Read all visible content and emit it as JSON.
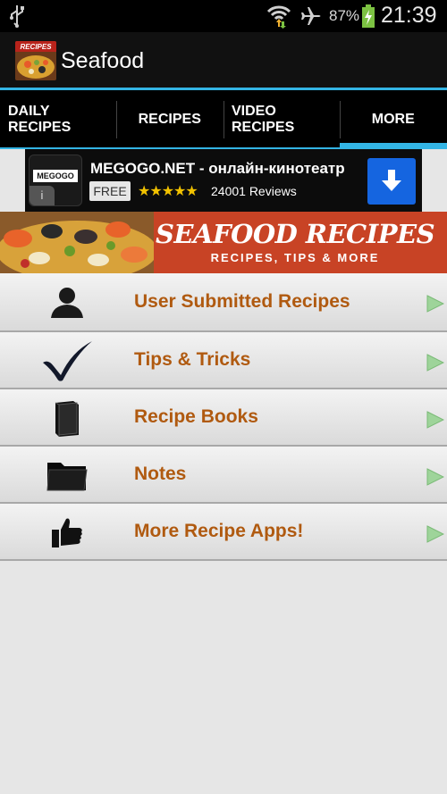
{
  "status_bar": {
    "battery_percent": "87%",
    "time": "21:39",
    "icons": [
      "usb-icon",
      "wifi-icon",
      "airplane-mode-icon",
      "battery-charging-icon"
    ]
  },
  "action_bar": {
    "title": "Seafood",
    "icon_text": "RECIPES"
  },
  "tabs": [
    {
      "label": "DAILY RECIPES",
      "active": false
    },
    {
      "label": "RECIPES",
      "active": false
    },
    {
      "label": "VIDEO RECIPES",
      "active": false
    },
    {
      "label": "MORE",
      "active": true
    }
  ],
  "ad": {
    "logo_text": "MEGOGO",
    "title": "MEGOGO.NET - онлайн-кинотеатр",
    "price_badge": "FREE",
    "stars": "★★★★★",
    "rating": 4.5,
    "reviews": "24001 Reviews",
    "info_icon": "i"
  },
  "banner": {
    "title": "SEAFOOD RECIPES",
    "subtitle": "RECIPES, TIPS & MORE"
  },
  "menu": [
    {
      "label": "User Submitted Recipes",
      "icon": "user-icon"
    },
    {
      "label": "Tips & Tricks",
      "icon": "checkmark-icon"
    },
    {
      "label": "Recipe Books",
      "icon": "book-icon"
    },
    {
      "label": "Notes",
      "icon": "folder-icon"
    },
    {
      "label": "More Recipe Apps!",
      "icon": "thumbs-up-icon"
    }
  ],
  "colors": {
    "accent": "#33b5e5",
    "menu_text": "#b05a10",
    "banner_bg": "#c84325",
    "download_button": "#1565e0"
  }
}
